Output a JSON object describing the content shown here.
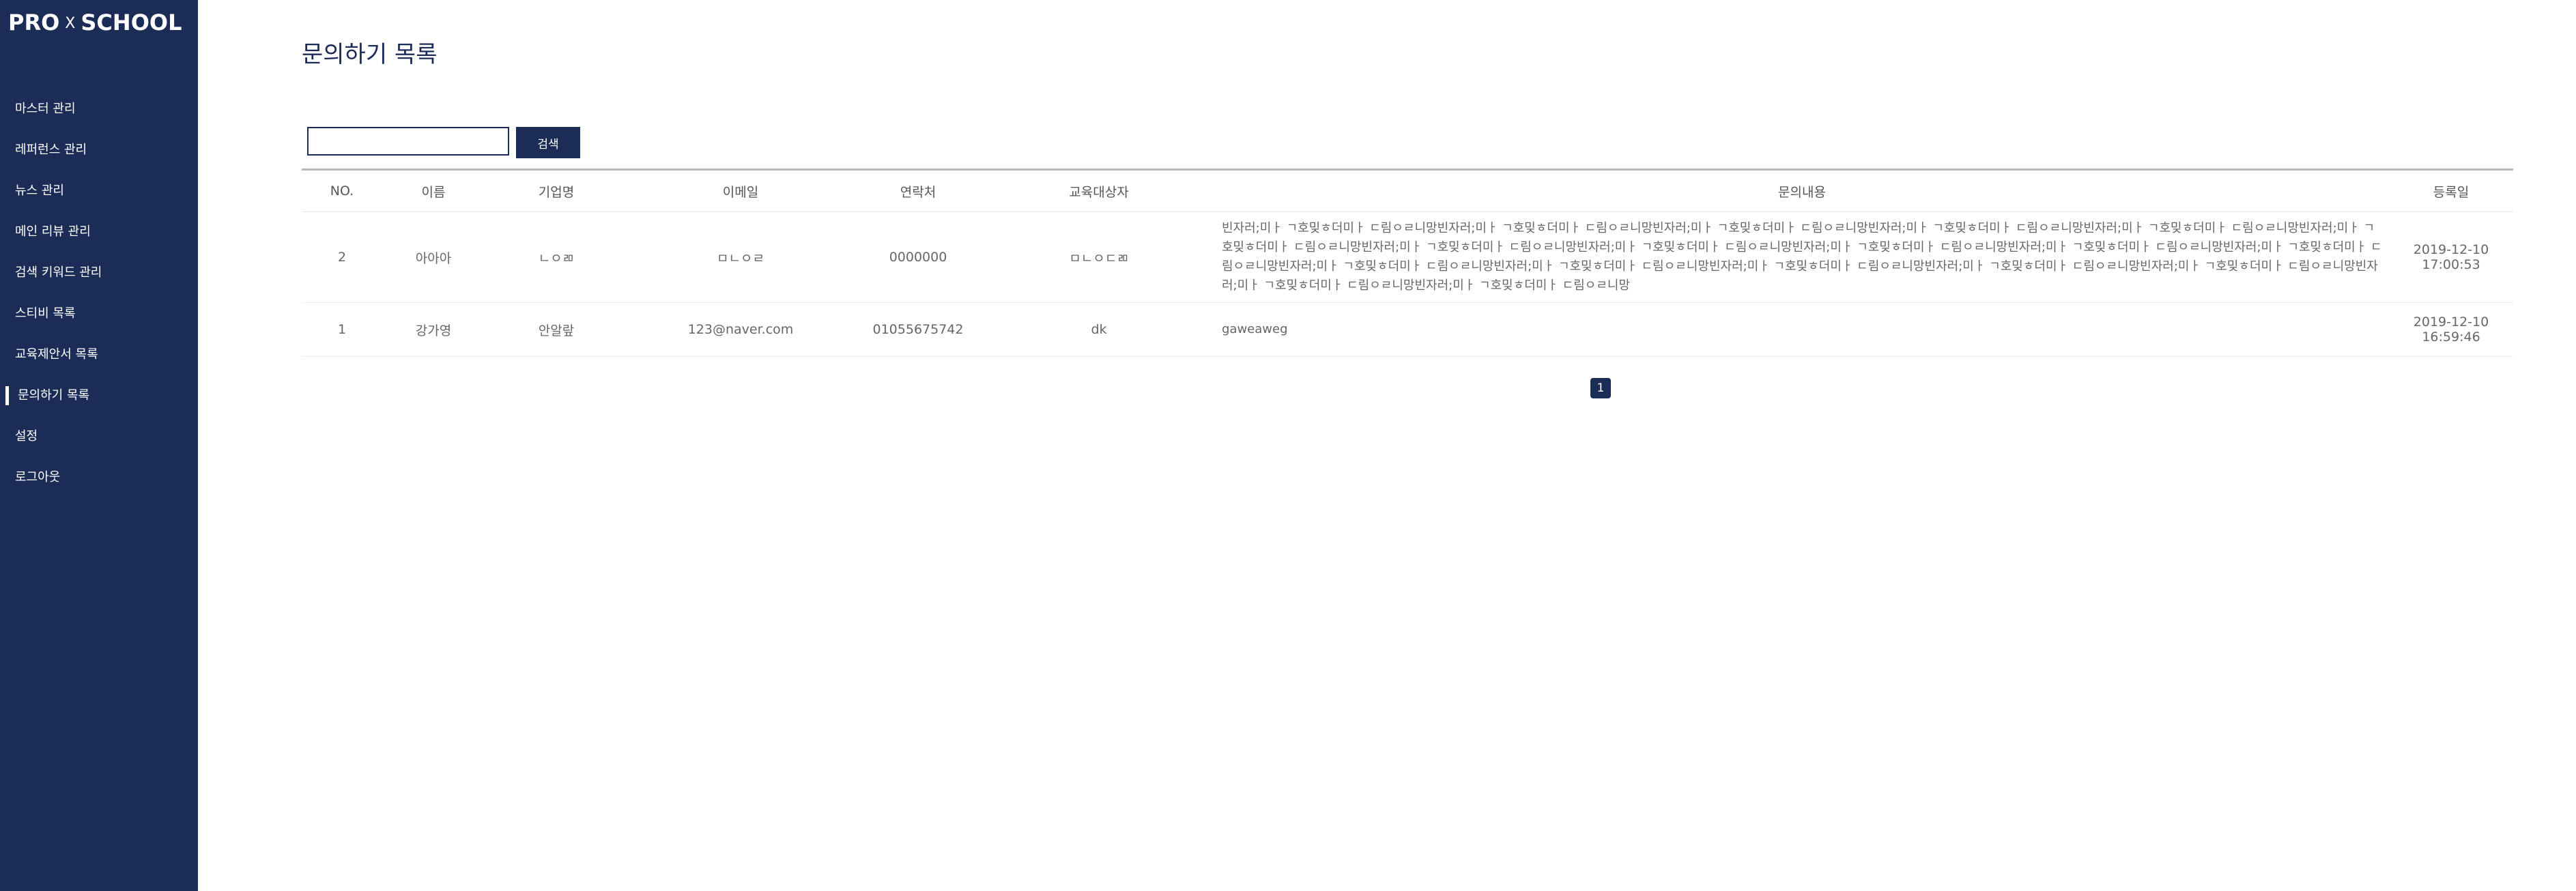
{
  "logo": {
    "left": "PRO",
    "mid": "X",
    "right": "SCHOOL"
  },
  "sidebar": {
    "items": [
      {
        "label": "마스터 관리"
      },
      {
        "label": "레퍼런스 관리"
      },
      {
        "label": "뉴스 관리"
      },
      {
        "label": "메인 리뷰 관리"
      },
      {
        "label": "검색 키워드 관리"
      },
      {
        "label": "스티비 목록"
      },
      {
        "label": "교육제안서 목록"
      },
      {
        "label": "문의하기 목록",
        "active": true
      },
      {
        "label": "설정"
      },
      {
        "label": "로그아웃"
      }
    ]
  },
  "page": {
    "title": "문의하기 목록"
  },
  "search": {
    "value": "",
    "placeholder": "",
    "button_label": "검색"
  },
  "table": {
    "headers": [
      "NO.",
      "이름",
      "기업명",
      "이메일",
      "연락처",
      "교육대상자",
      "문의내용",
      "등록일"
    ],
    "rows": [
      {
        "no": "2",
        "name": "아아아",
        "company": "ㄴㅇㄻ",
        "email": "ㅁㄴㅇㄹ",
        "phone": "0000000",
        "target": "ㅁㄴㅇㄷㄻ",
        "content": "빈자러;미ㅏ ㄱ호밎ㅎ더미ㅏ ㄷ림ㅇㄹ니망빈자러;미ㅏ ㄱ호밎ㅎ더미ㅏ ㄷ림ㅇㄹ니망빈자러;미ㅏ ㄱ호밎ㅎ더미ㅏ ㄷ림ㅇㄹ니망빈자러;미ㅏ ㄱ호밎ㅎ더미ㅏ ㄷ림ㅇㄹ니망빈자러;미ㅏ ㄱ호밎ㅎ더미ㅏ ㄷ림ㅇㄹ니망빈자러;미ㅏ ㄱ호밎ㅎ더미ㅏ ㄷ림ㅇㄹ니망빈자러;미ㅏ ㄱ호밎ㅎ더미ㅏ ㄷ림ㅇㄹ니망빈자러;미ㅏ ㄱ호밎ㅎ더미ㅏ ㄷ림ㅇㄹ니망빈자러;미ㅏ ㄱ호밎ㅎ더미ㅏ ㄷ림ㅇㄹ니망빈자러;미ㅏ ㄱ호밎ㅎ더미ㅏ ㄷ림ㅇㄹ니망빈자러;미ㅏ ㄱ호밎ㅎ더미ㅏ ㄷ림ㅇㄹ니망빈자러;미ㅏ ㄱ호밎ㅎ더미ㅏ ㄷ림ㅇㄹ니망빈자러;미ㅏ ㄱ호밎ㅎ더미ㅏ ㄷ림ㅇㄹ니망빈자러;미ㅏ ㄱ호밎ㅎ더미ㅏ ㄷ림ㅇㄹ니망빈자러;미ㅏ ㄱ호밎ㅎ더미ㅏ ㄷ림ㅇㄹ니망빈자러;미ㅏ ㄱ호밎ㅎ더미ㅏ ㄷ림ㅇㄹ니망빈자러;미ㅏ ㄱ호밎ㅎ더미ㅏ ㄷ림ㅇㄹ니망빈자러;미ㅏ ㄱ호밎ㅎ더미ㅏ ㄷ림ㅇㄹ니망",
        "date": "2019-12-10 17:00:53"
      },
      {
        "no": "1",
        "name": "강가영",
        "company": "안알랖",
        "email": "123@naver.com",
        "phone": "01055675742",
        "target": "dk",
        "content": "gaweaweg",
        "date": "2019-12-10 16:59:46"
      }
    ]
  },
  "pagination": {
    "current": "1"
  },
  "colors": {
    "navy": "#1b2d57",
    "white": "#ffffff"
  }
}
